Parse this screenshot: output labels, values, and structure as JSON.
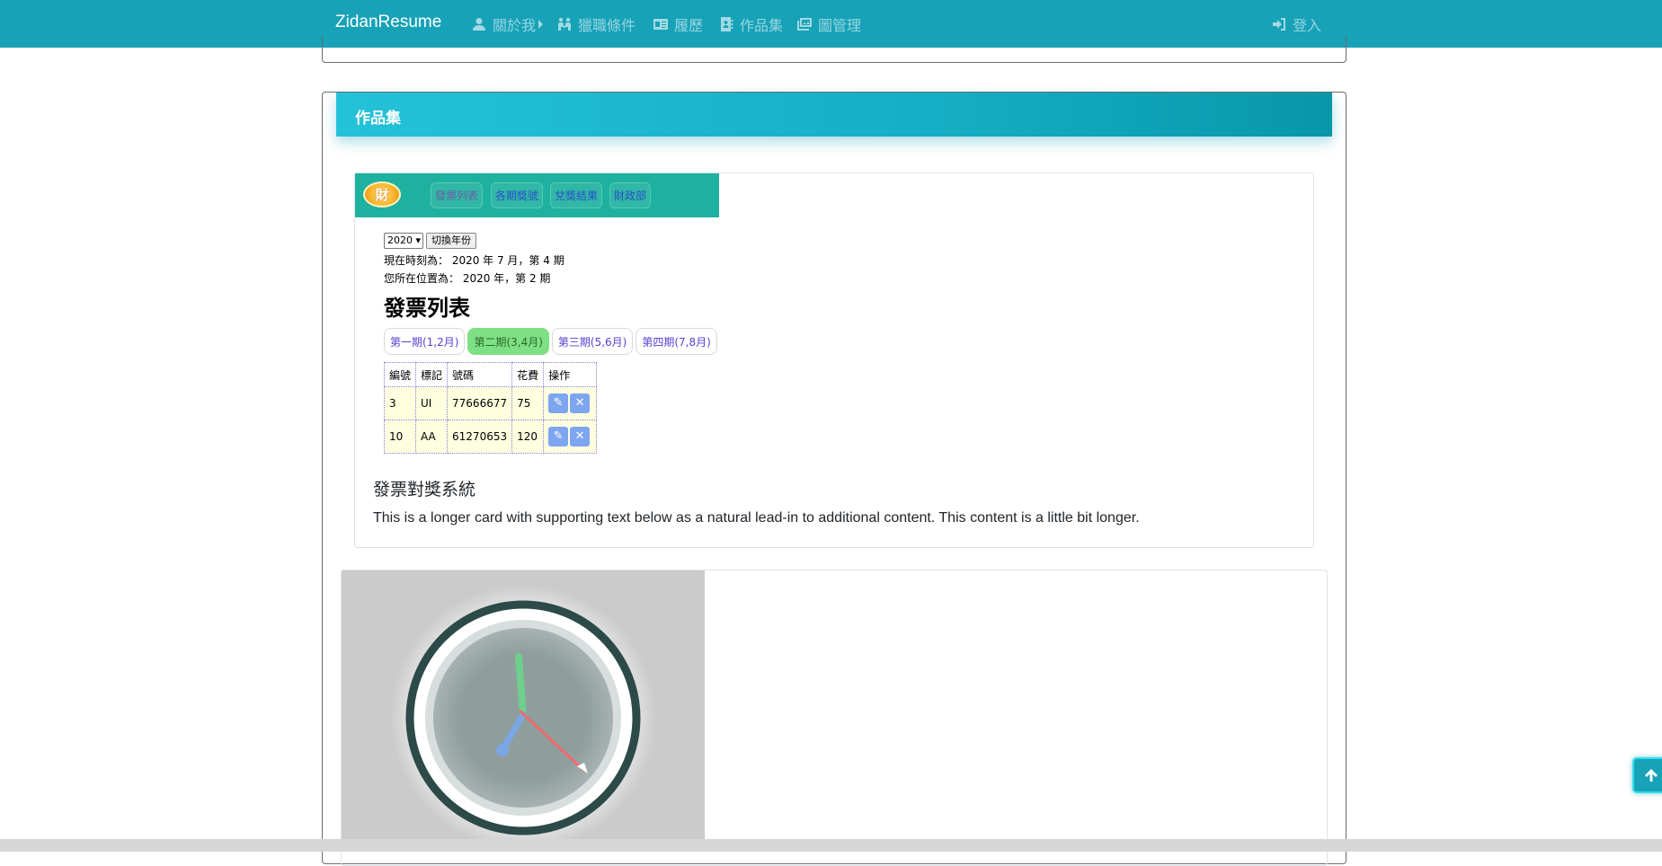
{
  "navbar": {
    "brand": "ZidanResume",
    "items": [
      {
        "label": "關於我",
        "icon": "user-icon"
      },
      {
        "label": "獵職條件",
        "icon": "handshake-icon"
      },
      {
        "label": "履歷",
        "icon": "id-card-icon"
      },
      {
        "label": "作品集",
        "icon": "address-book-icon"
      },
      {
        "label": "圖管理",
        "icon": "images-icon"
      }
    ],
    "login": {
      "label": "登入",
      "icon": "sign-in-icon"
    }
  },
  "section": {
    "title": "作品集"
  },
  "card1": {
    "app": {
      "logo_text": "財",
      "tabs": [
        "發票列表",
        "各期獎號",
        "兌獎結果",
        "財政部"
      ],
      "year_value": "2020",
      "year_button": "切換年份",
      "now_text": "現在時刻為： 2020 年 7 月，第 4 期",
      "location_text": "您所在位置為： 2020 年，第 2 期",
      "heading": "發票列表",
      "periods": [
        "第一期(1,2月)",
        "第二期(3,4月)",
        "第三期(5,6月)",
        "第四期(7,8月)"
      ],
      "table_headers": [
        "編號",
        "標記",
        "號碼",
        "花費",
        "操作"
      ],
      "rows": [
        {
          "id": "3",
          "tag": "UI",
          "number": "77666677",
          "cost": "75"
        },
        {
          "id": "10",
          "tag": "AA",
          "number": "61270653",
          "cost": "120"
        }
      ]
    },
    "title": "發票對獎系統",
    "text": "This is a longer card with supporting text below as a natural lead-in to additional content. This content is a little bit longer."
  },
  "colors": {
    "navbar": "#17a2b8",
    "header_gradient_start": "#24c2d8",
    "header_gradient_end": "#0797a9"
  }
}
